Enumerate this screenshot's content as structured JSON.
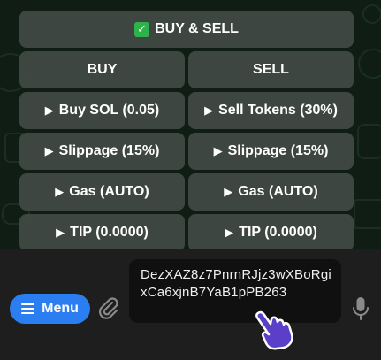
{
  "keyboard": {
    "header": {
      "label": "BUY & SELL",
      "icon": "check-box-icon"
    },
    "tabs": [
      {
        "label": "BUY"
      },
      {
        "label": "SELL"
      }
    ],
    "rows": [
      {
        "left": "Buy SOL (0.05)",
        "right": "Sell Tokens (30%)"
      },
      {
        "left": "Slippage (15%)",
        "right": "Slippage (15%)"
      },
      {
        "left": "Gas (AUTO)",
        "right": "Gas (AUTO)"
      },
      {
        "left": "TIP (0.0000)",
        "right": "TIP (0.0000)"
      }
    ],
    "row_icon": "play-triangle-icon",
    "triangle_glyph": "▶"
  },
  "composer": {
    "menu_label": "Menu",
    "input_value": "DezXAZ8z7PnrnRJjz3wXBoRgixCa6xjnB7YaB1pPB263",
    "attach_icon": "paperclip-icon",
    "mic_icon": "microphone-icon",
    "cursor_icon": "pointer-hand-icon"
  },
  "colors": {
    "accent": "#2b7df2",
    "check": "#2eb34a",
    "button_bg": "#434a46",
    "bar_bg": "#1e1e1e",
    "cursor": "#5b3fc9"
  }
}
